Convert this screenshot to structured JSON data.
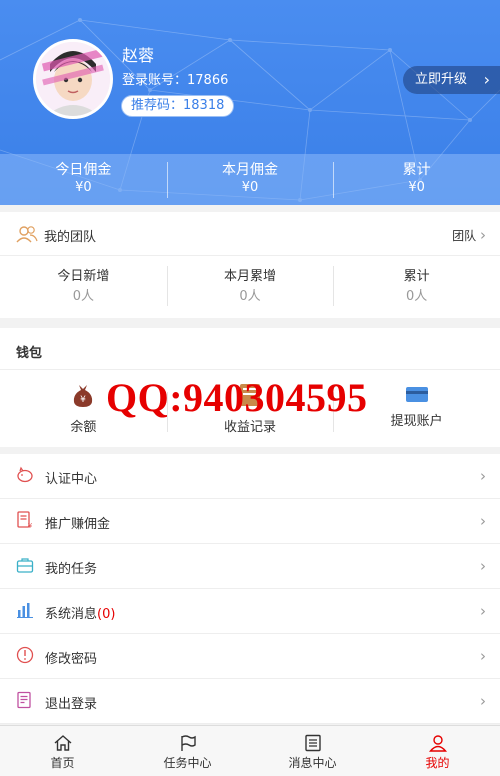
{
  "profile": {
    "name": "赵蓉",
    "account_label": "登录账号：17866",
    "referral_label": "推荐码：18318",
    "upgrade_label": "立即升级"
  },
  "earnings": [
    {
      "title": "今日佣金",
      "value": "¥0"
    },
    {
      "title": "本月佣金",
      "value": "¥0"
    },
    {
      "title": "累计",
      "value": "¥0"
    }
  ],
  "team": {
    "title": "我的团队",
    "link": "团队",
    "stats": [
      {
        "title": "今日新增",
        "value": "0人"
      },
      {
        "title": "本月累增",
        "value": "0人"
      },
      {
        "title": "累计",
        "value": "0人"
      }
    ]
  },
  "wallet": {
    "title": "钱包",
    "items": [
      {
        "label": "余额",
        "icon": "money-bag-icon"
      },
      {
        "label": "收益记录",
        "icon": "ledger-icon"
      },
      {
        "label": "提现账户",
        "icon": "card-icon"
      }
    ]
  },
  "watermark": "QQ:940304595",
  "menu": [
    {
      "label": "认证中心",
      "icon": "piggy-bank-icon"
    },
    {
      "label": "推广赚佣金",
      "icon": "document-yen-icon"
    },
    {
      "label": "我的任务",
      "icon": "briefcase-icon"
    },
    {
      "label": "系统消息",
      "count": "(0)",
      "icon": "bar-chart-icon"
    },
    {
      "label": "修改密码",
      "icon": "alert-circle-icon"
    },
    {
      "label": "退出登录",
      "icon": "edit-doc-icon"
    }
  ],
  "nav": [
    {
      "label": "首页",
      "icon": "home-icon"
    },
    {
      "label": "任务中心",
      "icon": "flag-icon"
    },
    {
      "label": "消息中心",
      "icon": "list-icon"
    },
    {
      "label": "我的",
      "icon": "user-icon",
      "active": true
    }
  ],
  "colors": {
    "primary": "#3a7fe8",
    "accent": "#e60000"
  }
}
